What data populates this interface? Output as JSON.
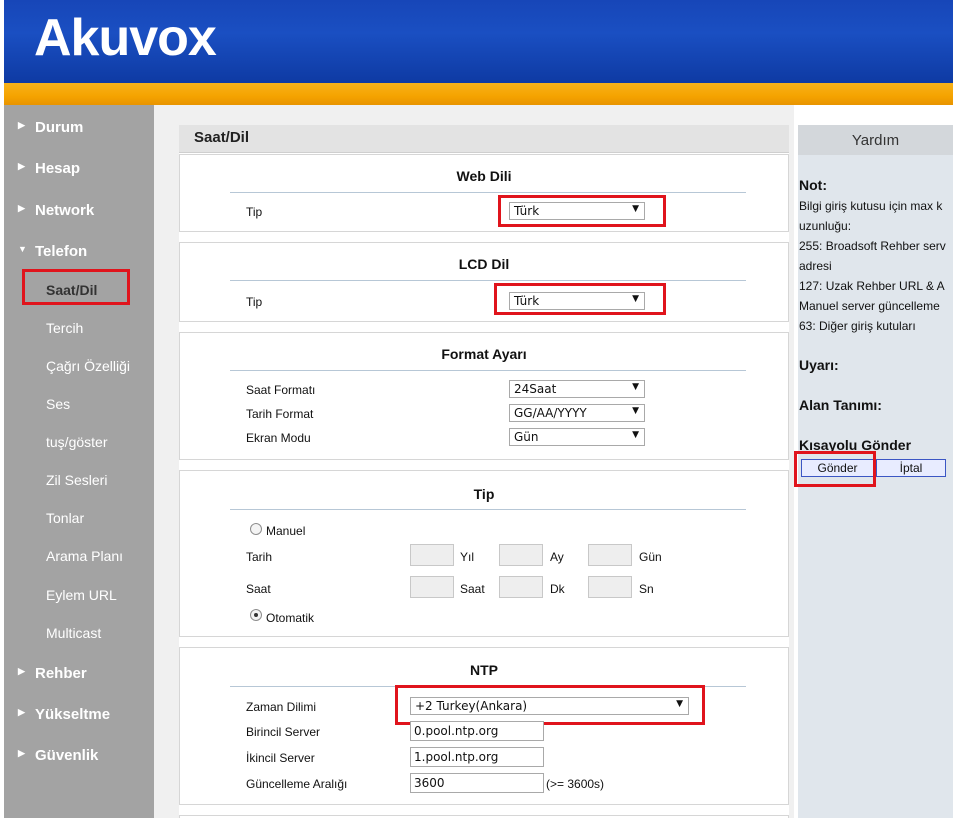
{
  "header": {
    "logo_text": "Akuvox"
  },
  "sidebar": {
    "items": [
      {
        "label": "Durum",
        "type": "top"
      },
      {
        "label": "Hesap",
        "type": "top"
      },
      {
        "label": "Network",
        "type": "top"
      },
      {
        "label": "Telefon",
        "type": "top",
        "expanded": true
      },
      {
        "label": "Saat/Dil",
        "type": "sub",
        "active": true
      },
      {
        "label": "Tercih",
        "type": "sub"
      },
      {
        "label": "Çağrı Özelliği",
        "type": "sub"
      },
      {
        "label": "Ses",
        "type": "sub"
      },
      {
        "label": "tuş/göster",
        "type": "sub"
      },
      {
        "label": "Zil Sesleri",
        "type": "sub"
      },
      {
        "label": "Tonlar",
        "type": "sub"
      },
      {
        "label": "Arama Planı",
        "type": "sub"
      },
      {
        "label": "Eylem URL",
        "type": "sub"
      },
      {
        "label": "Multicast",
        "type": "sub"
      },
      {
        "label": "Rehber",
        "type": "top"
      },
      {
        "label": "Yükseltme",
        "type": "top"
      },
      {
        "label": "Güvenlik",
        "type": "top"
      }
    ]
  },
  "main": {
    "title": "Saat/Dil",
    "web_dili": {
      "title": "Web Dili",
      "tip_label": "Tip",
      "tip_value": "Türk"
    },
    "lcd_dil": {
      "title": "LCD Dil",
      "tip_label": "Tip",
      "tip_value": "Türk"
    },
    "format": {
      "title": "Format Ayarı",
      "saat_format_label": "Saat Formatı",
      "saat_format_value": "24Saat",
      "tarih_format_label": "Tarih Format",
      "tarih_format_value": "GG/AA/YYYY",
      "ekran_modu_label": "Ekran Modu",
      "ekran_modu_value": "Gün"
    },
    "tip": {
      "title": "Tip",
      "manuel_label": "Manuel",
      "tarih_label": "Tarih",
      "yil_label": "Yıl",
      "ay_label": "Ay",
      "gun_label": "Gün",
      "saat_label": "Saat",
      "saat_unit_label": "Saat",
      "dk_label": "Dk",
      "sn_label": "Sn",
      "otomatik_label": "Otomatik",
      "selected": "Otomatik"
    },
    "ntp": {
      "title": "NTP",
      "zaman_dilimi_label": "Zaman Dilimi",
      "zaman_dilimi_value": "+2 Turkey(Ankara)",
      "birincil_label": "Birincil Server",
      "birincil_value": "0.pool.ntp.org",
      "ikincil_label": "İkincil Server",
      "ikincil_value": "1.pool.ntp.org",
      "guncelleme_label": "Güncelleme Aralığı",
      "guncelleme_value": "3600",
      "guncelleme_hint": "(>= 3600s)"
    }
  },
  "help": {
    "title": "Yardım",
    "not_heading": "Not:",
    "not_lines": [
      "Bilgi giriş kutusu için max k",
      "uzunluğu:",
      "255: Broadsoft Rehber serv",
      "adresi",
      "127: Uzak Rehber URL & A",
      "Manuel server güncelleme",
      "63: Diğer giriş kutuları"
    ],
    "uyari_heading": "Uyarı:",
    "alan_heading": "Alan Tanımı:",
    "kisayol_heading": "Kısayolu Gönder",
    "gonder_label": "Gönder",
    "iptal_label": "İptal"
  },
  "colors": {
    "header_blue": "#1a4fc2",
    "orange_bar": "#f5a300",
    "sidebar_gray": "#a3a3a3",
    "highlight_red": "#e0141c"
  }
}
